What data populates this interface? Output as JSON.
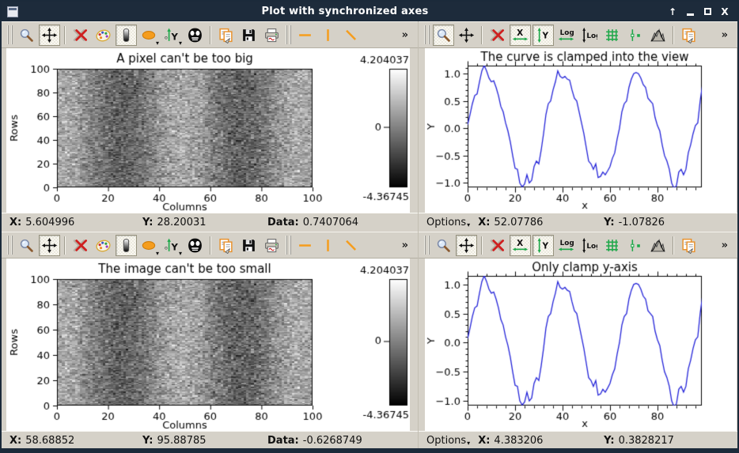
{
  "titlebar": {
    "title": "Plot with synchronized axes",
    "shade_glyph": "↑",
    "close_glyph": "X"
  },
  "toolbar": {
    "overflow_label": "»"
  },
  "icon_labels": {
    "xrange": "X",
    "yrange": "Y",
    "log": "Log",
    "axes": "Y",
    "axes_sub": "o"
  },
  "colors": {
    "titlebar_bg": "#1d2b3b",
    "chrome_bg": "#d5d1c8",
    "curve_color": "#2323d8",
    "toolbar_green": "#1fa84a",
    "toolbar_orange": "#f59d1e",
    "delete_red": "#cf1f1f"
  },
  "shared": {
    "curve_y": [
      0.07,
      0.25,
      0.45,
      0.6,
      0.63,
      0.85,
      1.05,
      1.15,
      1.05,
      0.92,
      0.85,
      0.87,
      0.75,
      0.6,
      0.4,
      0.3,
      0.1,
      -0.05,
      -0.25,
      -0.5,
      -0.73,
      -0.75,
      -1.0,
      -1.07,
      -1.02,
      -0.85,
      -1.0,
      -0.95,
      -0.7,
      -0.6,
      -0.65,
      -0.4,
      -0.1,
      0.25,
      0.45,
      0.5,
      0.7,
      0.85,
      1.05,
      0.95,
      0.92,
      0.95,
      0.9,
      0.88,
      0.7,
      0.55,
      0.5,
      0.3,
      0.1,
      -0.1,
      -0.35,
      -0.6,
      -0.65,
      -0.75,
      -0.65,
      -0.9,
      -0.88,
      -0.8,
      -0.85,
      -0.78,
      -0.7,
      -0.55,
      -0.45,
      -0.2,
      0.0,
      0.3,
      0.45,
      0.5,
      0.75,
      0.9,
      1.0,
      1.02,
      1.0,
      0.92,
      0.8,
      0.75,
      0.55,
      0.5,
      0.45,
      0.2,
      0.05,
      -0.05,
      -0.3,
      -0.5,
      -0.6,
      -0.75,
      -1.0,
      -1.1,
      -1.05,
      -0.8,
      -0.75,
      -0.85,
      -0.75,
      -0.45,
      -0.3,
      -0.1,
      0.05,
      0.1,
      0.5,
      0.8
    ]
  },
  "chart_data": [
    {
      "id": "image-top-left",
      "type": "heatmap",
      "title": "A pixel can't be too big",
      "xlabel": "Columns",
      "ylabel": "Rows",
      "xlim": [
        0,
        100
      ],
      "ylim": [
        0,
        100
      ],
      "xtick_labels": [
        "0",
        "20",
        "40",
        "60",
        "80",
        "100"
      ],
      "ytick_labels": [
        "0",
        "20",
        "40",
        "60",
        "80",
        "100"
      ],
      "colormap": "gray (white=max, black=min)",
      "colorbar": {
        "max_label": "4.204037",
        "min_label": "-4.36745",
        "zero_label": "0"
      },
      "data_description": "100x100 random gaussian noise image, values in [-4.36745, 4.204037], with faint dark vertical bands near columns 25 and 60"
    },
    {
      "id": "curve-top-right",
      "type": "line",
      "title": "The curve is clamped into the view",
      "xlabel": "x",
      "ylabel": "Y",
      "xlim": [
        0,
        98.7
      ],
      "ylim": [
        -1.08,
        1.147
      ],
      "xtick_labels": [
        "0",
        "20",
        "40",
        "60",
        "80"
      ],
      "ytick_labels": [
        "−1.0",
        "−0.5",
        "0.0",
        "0.5",
        "1.0"
      ],
      "yticks": [
        -1.0,
        -0.5,
        0.0,
        0.5,
        1.0
      ],
      "xticks": [
        0,
        20,
        40,
        60,
        80
      ],
      "series_note": "noisy sine wave, period ~32, amplitude ~1, 100 points",
      "y_key": "curve_y"
    },
    {
      "id": "image-bottom-left",
      "type": "heatmap",
      "title": "The image can't be too small",
      "xlabel": "Columns",
      "ylabel": "Rows",
      "xlim": [
        0,
        100
      ],
      "ylim": [
        0,
        100
      ],
      "xtick_labels": [
        "0",
        "20",
        "40",
        "60",
        "80",
        "100"
      ],
      "ytick_labels": [
        "0",
        "20",
        "40",
        "60",
        "80",
        "100"
      ],
      "colormap": "gray (white=max, black=min)",
      "colorbar": {
        "max_label": "4.204037",
        "min_label": "-4.36745",
        "zero_label": "0"
      },
      "data_description": "same 100x100 gaussian noise image shown in top-left panel"
    },
    {
      "id": "curve-bottom-right",
      "type": "line",
      "title": "Only clamp y-axis",
      "xlabel": "x",
      "ylabel": "Y",
      "xlim": [
        0,
        98.7
      ],
      "ylim": [
        -1.08,
        1.147
      ],
      "xtick_labels": [
        "0",
        "20",
        "40",
        "60",
        "80"
      ],
      "ytick_labels": [
        "−1.0",
        "−0.5",
        "0.0",
        "0.5",
        "1.0"
      ],
      "yticks": [
        -1.0,
        -0.5,
        0.0,
        0.5,
        1.0
      ],
      "xticks": [
        0,
        20,
        40,
        60,
        80
      ],
      "series_note": "same noisy sine series as top-right panel",
      "y_key": "curve_y"
    }
  ],
  "panels": [
    {
      "id": "top-left",
      "kind": "image",
      "chart": 0,
      "toolbar": [
        {
          "t": "handle"
        },
        {
          "n": "zoom"
        },
        {
          "n": "pan",
          "sel": true
        },
        {
          "t": "sep"
        },
        {
          "n": "delete"
        },
        {
          "n": "palette"
        },
        {
          "n": "contrast",
          "sel": true
        },
        {
          "n": "ellipse",
          "car": true
        },
        {
          "n": "axes",
          "car": true
        },
        {
          "n": "mask"
        },
        {
          "t": "sep"
        },
        {
          "n": "copy"
        },
        {
          "n": "save"
        },
        {
          "n": "print"
        },
        {
          "t": "handle"
        },
        {
          "n": "hline"
        },
        {
          "n": "vline"
        },
        {
          "n": "oline"
        }
      ],
      "status": {
        "items": [
          {
            "label": "X:",
            "value": "5.604996"
          },
          {
            "label": "Y:",
            "value": "28.20031"
          },
          {
            "label": "Data:",
            "value": "0.7407064"
          }
        ]
      }
    },
    {
      "id": "top-right",
      "kind": "curve",
      "chart": 1,
      "toolbar": [
        {
          "t": "handle"
        },
        {
          "n": "zoom",
          "sel": true
        },
        {
          "n": "pan"
        },
        {
          "t": "sep"
        },
        {
          "n": "delete"
        },
        {
          "n": "xrange",
          "sel": true
        },
        {
          "n": "yrange",
          "sel": true
        },
        {
          "n": "logx"
        },
        {
          "n": "logy"
        },
        {
          "n": "grid"
        },
        {
          "n": "cursor"
        },
        {
          "n": "histogram"
        },
        {
          "t": "sep"
        },
        {
          "n": "copy"
        }
      ],
      "status": {
        "options_label": "Options",
        "options_caret": "▾",
        "items": [
          {
            "label": "X:",
            "value": "52.07786"
          },
          {
            "label": "Y:",
            "value": "-1.07826"
          }
        ]
      }
    },
    {
      "id": "bottom-left",
      "kind": "image",
      "chart": 2,
      "toolbar": [
        {
          "t": "handle"
        },
        {
          "n": "zoom"
        },
        {
          "n": "pan",
          "sel": true
        },
        {
          "t": "sep"
        },
        {
          "n": "delete"
        },
        {
          "n": "palette"
        },
        {
          "n": "contrast",
          "sel": true
        },
        {
          "n": "ellipse",
          "car": true
        },
        {
          "n": "axes",
          "car": true
        },
        {
          "n": "mask"
        },
        {
          "t": "sep"
        },
        {
          "n": "copy"
        },
        {
          "n": "save"
        },
        {
          "n": "print"
        },
        {
          "t": "handle"
        },
        {
          "n": "hline"
        },
        {
          "n": "vline"
        },
        {
          "n": "oline"
        }
      ],
      "status": {
        "items": [
          {
            "label": "X:",
            "value": "58.68852"
          },
          {
            "label": "Y:",
            "value": "95.88785"
          },
          {
            "label": "Data:",
            "value": "-0.6268749"
          }
        ]
      }
    },
    {
      "id": "bottom-right",
      "kind": "curve",
      "chart": 3,
      "toolbar": [
        {
          "t": "handle"
        },
        {
          "n": "zoom"
        },
        {
          "n": "pan",
          "sel": true
        },
        {
          "t": "sep"
        },
        {
          "n": "delete"
        },
        {
          "n": "xrange",
          "sel": true
        },
        {
          "n": "yrange",
          "sel": true
        },
        {
          "n": "logx"
        },
        {
          "n": "logy"
        },
        {
          "n": "grid"
        },
        {
          "n": "cursor"
        },
        {
          "n": "histogram"
        },
        {
          "t": "sep"
        },
        {
          "n": "copy"
        }
      ],
      "status": {
        "options_label": "Options",
        "options_caret": "▾",
        "items": [
          {
            "label": "X:",
            "value": "4.383206"
          },
          {
            "label": "Y:",
            "value": "0.3828217"
          }
        ]
      }
    }
  ]
}
